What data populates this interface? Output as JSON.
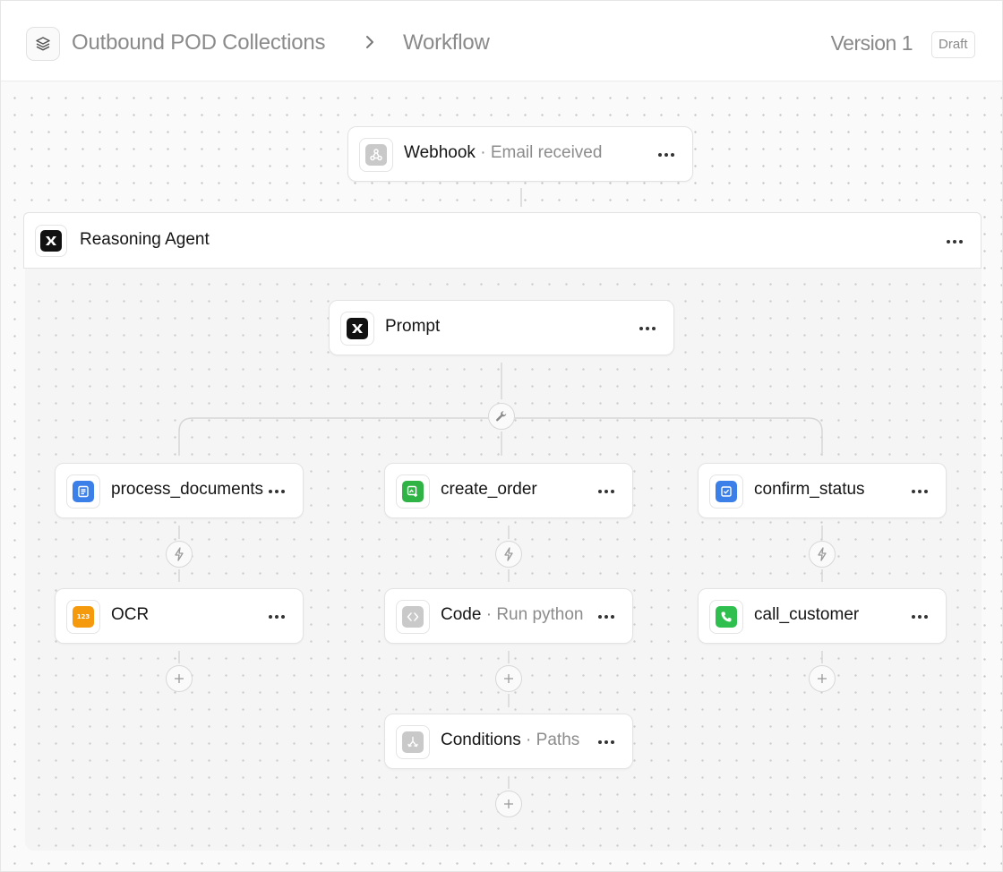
{
  "header": {
    "breadcrumb": [
      "Outbound POD Collections",
      "Workflow"
    ],
    "version": "Version 1",
    "status_badge": "Draft"
  },
  "nodes": {
    "webhook": {
      "title": "Webhook",
      "subtitle": "Email received",
      "icon": "webhook-icon"
    },
    "agent": {
      "title": "Reasoning Agent",
      "icon": "agent-logo-icon"
    },
    "prompt": {
      "title": "Prompt",
      "icon": "agent-logo-icon"
    },
    "process_documents": {
      "title": "process_documents",
      "icon": "document-icon",
      "color": "#3b7fe8"
    },
    "create_order": {
      "title": "create_order",
      "icon": "add-image-icon",
      "color": "#2fb344"
    },
    "confirm_status": {
      "title": "confirm_status",
      "icon": "checkbox-icon",
      "color": "#3b7fe8"
    },
    "ocr": {
      "title": "OCR",
      "icon": "ocr-123-icon",
      "color": "#f59a0c",
      "chip_text": "123"
    },
    "code": {
      "title": "Code",
      "subtitle": "Run python",
      "icon": "code-icon"
    },
    "call_customer": {
      "title": "call_customer",
      "icon": "phone-icon",
      "color": "#2fbf4e"
    },
    "conditions": {
      "title": "Conditions",
      "subtitle": "Paths",
      "icon": "branch-icon"
    }
  },
  "colors": {
    "accent_blue": "#3b7fe8",
    "accent_green": "#2fb344",
    "accent_orange": "#f59a0c"
  }
}
